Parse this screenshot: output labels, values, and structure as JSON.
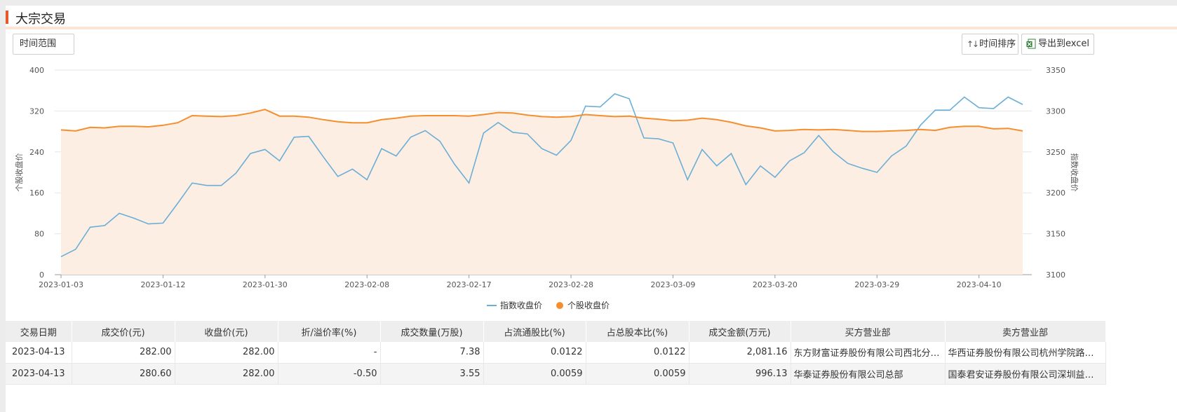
{
  "header": {
    "title": "大宗交易"
  },
  "toolbar": {
    "range_label": "时间范围",
    "sort_label": "时间排序",
    "export_label": "导出到excel",
    "sort_icon": "sort-arrows-icon",
    "export_icon": "excel-icon"
  },
  "colors": {
    "accent": "#e8572a",
    "index_line": "#6baed6",
    "stock_line": "#f58f2e",
    "stock_area": "#fdeee3"
  },
  "chart_data": {
    "type": "line",
    "title": "",
    "x": [
      "2023-01-03",
      "2023-01-04",
      "2023-01-05",
      "2023-01-06",
      "2023-01-09",
      "2023-01-10",
      "2023-01-11",
      "2023-01-12",
      "2023-01-13",
      "2023-01-16",
      "2023-01-17",
      "2023-01-18",
      "2023-01-19",
      "2023-01-20",
      "2023-01-30",
      "2023-01-31",
      "2023-02-01",
      "2023-02-02",
      "2023-02-03",
      "2023-02-06",
      "2023-02-07",
      "2023-02-08",
      "2023-02-09",
      "2023-02-10",
      "2023-02-13",
      "2023-02-14",
      "2023-02-15",
      "2023-02-16",
      "2023-02-17",
      "2023-02-20",
      "2023-02-21",
      "2023-02-22",
      "2023-02-23",
      "2023-02-24",
      "2023-02-27",
      "2023-02-28",
      "2023-03-01",
      "2023-03-02",
      "2023-03-03",
      "2023-03-06",
      "2023-03-07",
      "2023-03-08",
      "2023-03-09",
      "2023-03-10",
      "2023-03-13",
      "2023-03-14",
      "2023-03-15",
      "2023-03-16",
      "2023-03-17",
      "2023-03-20",
      "2023-03-21",
      "2023-03-22",
      "2023-03-23",
      "2023-03-24",
      "2023-03-27",
      "2023-03-28",
      "2023-03-29",
      "2023-03-30",
      "2023-03-31",
      "2023-04-03",
      "2023-04-04",
      "2023-04-06",
      "2023-04-07",
      "2023-04-10",
      "2023-04-11",
      "2023-04-12",
      "2023-04-13"
    ],
    "x_tick_labels": [
      "2023-01-03",
      "2023-01-12",
      "2023-01-30",
      "2023-02-08",
      "2023-02-17",
      "2023-02-28",
      "2023-03-09",
      "2023-03-20",
      "2023-03-29",
      "2023-04-10"
    ],
    "x_tick_indices": [
      0,
      7,
      14,
      21,
      28,
      35,
      42,
      49,
      56,
      63
    ],
    "series": [
      {
        "name": "指数收盘价",
        "axis": "right",
        "values": [
          3122,
          3131,
          3158,
          3160,
          3175,
          3169,
          3162,
          3163,
          3187,
          3212,
          3209,
          3209,
          3224,
          3248,
          3253,
          3239,
          3268,
          3269,
          3244,
          3220,
          3229,
          3216,
          3254,
          3245,
          3268,
          3276,
          3263,
          3235,
          3212,
          3273,
          3286,
          3274,
          3272,
          3254,
          3246,
          3264,
          3306,
          3305,
          3321,
          3315,
          3267,
          3266,
          3261,
          3216,
          3253,
          3233,
          3248,
          3210,
          3233,
          3219,
          3239,
          3249,
          3270,
          3250,
          3236,
          3230,
          3225,
          3245,
          3257,
          3283,
          3301,
          3301,
          3317,
          3304,
          3303,
          3317,
          3308
        ]
      },
      {
        "name": "个股收盘价",
        "axis": "left",
        "values": [
          283,
          281,
          288,
          287,
          290,
          290,
          289,
          292,
          297,
          311,
          310,
          309,
          311,
          316,
          323,
          310,
          310,
          308,
          303,
          299,
          297,
          297,
          303,
          306,
          310,
          311,
          311,
          311,
          310,
          313,
          317,
          316,
          312,
          309,
          308,
          309,
          313,
          311,
          309,
          310,
          306,
          304,
          301,
          302,
          306,
          303,
          298,
          291,
          287,
          281,
          282,
          284,
          283,
          284,
          282,
          280,
          280,
          281,
          282,
          284,
          282,
          288,
          290,
          290,
          285,
          286,
          281
        ]
      }
    ],
    "ylabel_left": "个股收盘价",
    "ylabel_right": "指数收盘价",
    "ylim_left": [
      0,
      400
    ],
    "ylim_right": [
      3100,
      3350
    ],
    "yticks_left": [
      "0",
      "80",
      "160",
      "240",
      "320",
      "400"
    ],
    "yticks_right": [
      "3100",
      "3150",
      "3200",
      "3250",
      "3300",
      "3350"
    ],
    "legend": {
      "position": "bottom-center",
      "items": [
        "指数收盘价",
        "个股收盘价"
      ]
    },
    "grid": true
  },
  "table": {
    "headers": [
      "交易日期",
      "成交价(元)",
      "收盘价(元)",
      "折/溢价率(%)",
      "成交数量(万股)",
      "占流通股比(%)",
      "占总股本比(%)",
      "成交金额(万元)",
      "买方营业部",
      "卖方营业部"
    ],
    "rows": [
      [
        "2023-04-13",
        "282.00",
        "282.00",
        "-",
        "7.38",
        "0.0122",
        "0.0122",
        "2,081.16",
        "东方财富证券股份有限公司西北分公司",
        "华西证券股份有限公司杭州学院路证券营业部"
      ],
      [
        "2023-04-13",
        "280.60",
        "282.00",
        "-0.50",
        "3.55",
        "0.0059",
        "0.0059",
        "996.13",
        "华泰证券股份有限公司总部",
        "国泰君安证券股份有限公司深圳益田路证券营业部"
      ]
    ]
  }
}
